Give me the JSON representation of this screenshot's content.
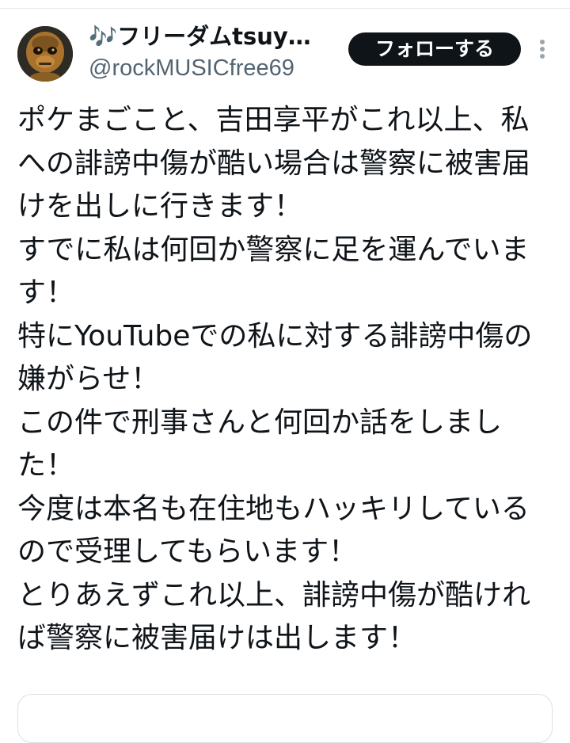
{
  "author": {
    "display_name": "🎶フリーダムtsuyoshi",
    "handle": "@rockMUSICfree69"
  },
  "follow_button_label": "フォローする",
  "tweet_lines": [
    "ポケまごこと、吉田享平がこれ以上、私",
    "への誹謗中傷が酷い場合は警察に被害届",
    "けを出しに行きます！",
    "すでに私は何回か警察に足を運んでいま",
    "す！",
    "特にYouTubeでの私に対する誹謗中傷の",
    "嫌がらせ！",
    "この件で刑事さんと何回か話をしまし",
    "た！",
    "今度は本名も在住地もハッキリしている",
    "ので受理してもらいます！",
    "とりあえずこれ以上、誹謗中傷が酷けれ",
    "ば警察に被害届けは出します！"
  ],
  "colors": {
    "text": "#0f1419",
    "secondary_text": "#536471",
    "button_bg": "#0f1419",
    "button_text": "#ffffff"
  },
  "icons": {
    "avatar": "monkey-statue-avatar",
    "more": "more-options-icon"
  }
}
